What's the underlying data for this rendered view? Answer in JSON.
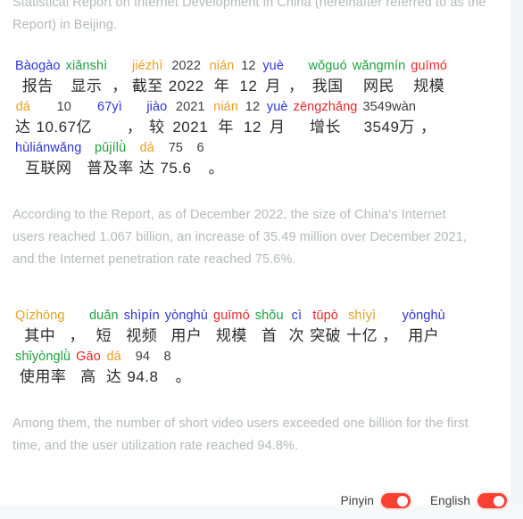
{
  "intro": {
    "line1": "Statistical Report on Internet Development in China (hereinafter referred to as the",
    "line2": "Report) in Beijing."
  },
  "colors": {
    "tone1": "#e8262a",
    "tone2": "#e8a020",
    "tone3": "#1f9e3e",
    "tone4": "#2b35d8",
    "neutral": "#3c3c3c",
    "translation_text": "#b6b8bd",
    "hanzi_text": "#2b2b2b",
    "toggle_on": "#fa3f33",
    "card_background": "#ffffff",
    "page_background": "#f4f5f7"
  },
  "passages": [
    {
      "id": "passage-1",
      "lines": [
        {
          "tokens": [
            {
              "pinyin": "Bàogào",
              "hanzi": "报告",
              "tone": "t4"
            },
            {
              "pinyin": "xiǎnshì",
              "hanzi": "显示",
              "tone": "t3"
            },
            {
              "pinyin": "",
              "hanzi": "，",
              "tone": "t0",
              "punct": true
            },
            {
              "pinyin": "jiézhì",
              "hanzi": "截至",
              "tone": "t2"
            },
            {
              "pinyin": "2022",
              "hanzi": "2022",
              "tone": "t0"
            },
            {
              "pinyin": "nián",
              "hanzi": "年",
              "tone": "t2"
            },
            {
              "pinyin": "12",
              "hanzi": "12",
              "tone": "t0"
            },
            {
              "pinyin": "yuè",
              "hanzi": "月",
              "tone": "t4"
            },
            {
              "pinyin": "",
              "hanzi": "，",
              "tone": "t0",
              "punct": true
            },
            {
              "pinyin": "wǒguó",
              "hanzi": "我国",
              "tone": "t3"
            },
            {
              "pinyin": "wǎngmín",
              "hanzi": "网民",
              "tone": "t3"
            },
            {
              "pinyin": "guīmó",
              "hanzi": "规模",
              "tone": "t1"
            }
          ]
        },
        {
          "tokens": [
            {
              "pinyin": "dá",
              "hanzi": "达",
              "tone": "t2"
            },
            {
              "pinyin": "10",
              "hanzi": "10.67亿",
              "tone": "t0"
            },
            {
              "pinyin": "67yì",
              "hanzi": "",
              "tone": "t4",
              "hidden_hanzi": true
            },
            {
              "pinyin": "",
              "hanzi": "，",
              "tone": "t0",
              "punct": true
            },
            {
              "pinyin": "jiào",
              "hanzi": "较",
              "tone": "t4"
            },
            {
              "pinyin": "2021",
              "hanzi": "2021",
              "tone": "t0"
            },
            {
              "pinyin": "nián",
              "hanzi": "年",
              "tone": "t2"
            },
            {
              "pinyin": "12",
              "hanzi": "12",
              "tone": "t0"
            },
            {
              "pinyin": "yuè",
              "hanzi": "月",
              "tone": "t4"
            },
            {
              "pinyin": "zēngzhǎng",
              "hanzi": "增长",
              "tone": "t1"
            },
            {
              "pinyin": "3549wàn",
              "hanzi": "3549万",
              "tone": "t0"
            },
            {
              "pinyin": "",
              "hanzi": "，",
              "tone": "t0",
              "punct": true
            }
          ]
        },
        {
          "tokens": [
            {
              "pinyin": "hùliánwǎng",
              "hanzi": "互联网",
              "tone": "t4"
            },
            {
              "pinyin": "pǔjílǜ",
              "hanzi": "普及率",
              "tone": "t3"
            },
            {
              "pinyin": "dá",
              "hanzi": "达",
              "tone": "t2"
            },
            {
              "pinyin": "75",
              "hanzi": "75.6",
              "tone": "t0"
            },
            {
              "pinyin": "6",
              "hanzi": "",
              "tone": "t0",
              "hidden_hanzi": true
            },
            {
              "pinyin": "",
              "hanzi": "。",
              "tone": "t0",
              "punct": true
            }
          ]
        }
      ],
      "translation": "According to the Report, as of December 2022, the size of China's Internet users reached 1.067 billion, an increase of 35.49 million over December 2021, and the Internet penetration rate reached 75.6%."
    },
    {
      "id": "passage-2",
      "lines": [
        {
          "tokens": [
            {
              "pinyin": "Qízhōng",
              "hanzi": "其中",
              "tone": "t2"
            },
            {
              "pinyin": "",
              "hanzi": "，",
              "tone": "t0",
              "punct": true
            },
            {
              "pinyin": "duǎn",
              "hanzi": "短",
              "tone": "t3"
            },
            {
              "pinyin": "shìpín",
              "hanzi": "视频",
              "tone": "t4"
            },
            {
              "pinyin": "yònghù",
              "hanzi": "用户",
              "tone": "t4"
            },
            {
              "pinyin": "guīmó",
              "hanzi": "规模",
              "tone": "t1"
            },
            {
              "pinyin": "shǒu",
              "hanzi": "首",
              "tone": "t3"
            },
            {
              "pinyin": "cì",
              "hanzi": "次",
              "tone": "t4"
            },
            {
              "pinyin": "tūpò",
              "hanzi": "突破",
              "tone": "t1"
            },
            {
              "pinyin": "shíyì",
              "hanzi": "十亿",
              "tone": "t2"
            },
            {
              "pinyin": "",
              "hanzi": "，",
              "tone": "t0",
              "punct": true
            },
            {
              "pinyin": "yònghù",
              "hanzi": "用户",
              "tone": "t4"
            }
          ]
        },
        {
          "tokens": [
            {
              "pinyin": "shǐyònglǜ",
              "hanzi": "使用率",
              "tone": "t3"
            },
            {
              "pinyin": "Gāo",
              "hanzi": "高",
              "tone": "t1"
            },
            {
              "pinyin": "dá",
              "hanzi": "达",
              "tone": "t2"
            },
            {
              "pinyin": "94",
              "hanzi": "94.8",
              "tone": "t0"
            },
            {
              "pinyin": "8",
              "hanzi": "",
              "tone": "t0",
              "hidden_hanzi": true
            },
            {
              "pinyin": "",
              "hanzi": "。",
              "tone": "t0",
              "punct": true
            }
          ]
        }
      ],
      "translation": "Among them, the number of short video users exceeded one billion for the first time, and the user utilization rate reached 94.8%."
    }
  ],
  "footer": {
    "pinyin_toggle": {
      "label": "Pinyin",
      "state": "on"
    },
    "english_toggle": {
      "label": "English",
      "state": "on"
    }
  }
}
